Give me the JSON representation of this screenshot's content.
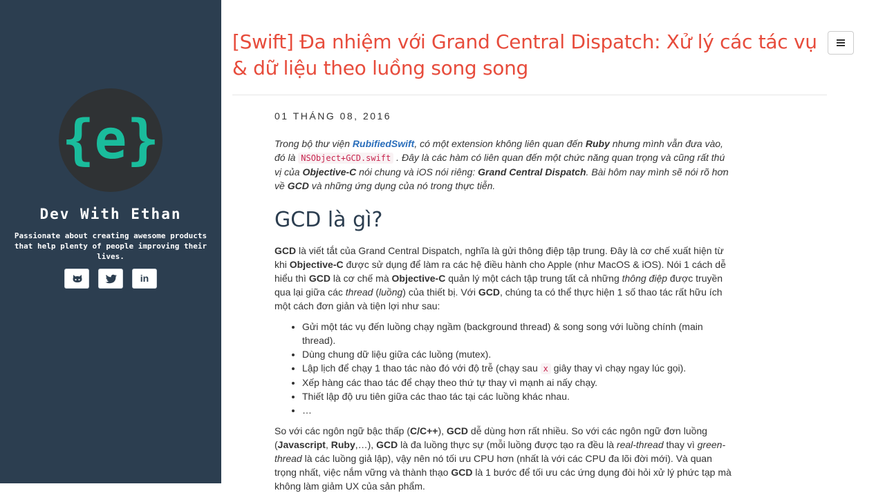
{
  "sidebar": {
    "avatar_glyph": "{e}",
    "site_title": "Dev With Ethan",
    "tagline": "Passionate about creating awesome products that help plenty of people improving their lives.",
    "socials": [
      {
        "icon": "github-icon"
      },
      {
        "icon": "twitter-icon"
      },
      {
        "icon": "linkedin-icon",
        "text": "in"
      }
    ],
    "colors": {
      "background": "#2c3e50",
      "avatar_accent": "#1abc9c"
    }
  },
  "header": {
    "title": "[Swift] Đa nhiệm với Grand Central Dispatch: Xử lý các tác vụ & dữ liệu theo luồng song song",
    "menu_icon": "hamburger-icon",
    "title_color": "#e74c3c"
  },
  "post": {
    "date": "01 tháng 08, 2016",
    "intro": {
      "t1": "Trong bộ thư viện ",
      "link": "RubifiedSwift",
      "t2": ", có một extension không liên quan đến ",
      "b1": "Ruby",
      "t3": " nhưng mình vẫn đưa vào, đó là ",
      "code": "NSObject+GCD.swift",
      "t4": " . Đây là các hàm có liên quan đến một chức năng quan trọng và cũng rất thú vị của ",
      "b2": "Objective-C",
      "t5": " nói chung và iOS nói riêng: ",
      "b3": "Grand Central Dispatch",
      "t6": ". Bài hôm nay mình sẽ nói rõ hơn về ",
      "b4": "GCD",
      "t7": " và những ứng dụng của nó trong thực tiễn."
    },
    "h2": "GCD là gì?",
    "p1": {
      "b1": "GCD",
      "t1": " là viết tắt của Grand Central Dispatch, nghĩa là gửi thông điệp tập trung. Đây là cơ chế xuất hiện từ khi ",
      "b2": "Objective-C",
      "t2": " được sử dụng để làm ra các hệ điều hành cho Apple (như MacOS & iOS). Nói 1 cách dễ hiểu thì ",
      "b3": "GCD",
      "t3": " là cơ chế mà ",
      "b4": "Objective-C",
      "t4": " quản lý một cách tập trung tất cả những ",
      "i1": "thông điệp",
      "t5": " được truyền qua lại giữa các ",
      "i2": "thread",
      "t6": " (",
      "i3": "luồng",
      "t7": ") của thiết bị. Với ",
      "b5": "GCD",
      "t8": ", chúng ta có thể thực hiện 1 số thao tác rất hữu ích một cách đơn giản và tiện lợi như sau:"
    },
    "list": {
      "i1": "Gửi một tác vụ đến luồng chạy ngầm (background thread) & song song với luồng chính (main thread).",
      "i2": "Dùng chung dữ liệu giữa các luồng (mutex).",
      "i3a": "Lập lịch để chạy 1 thao tác nào đó với độ trễ (chạy sau ",
      "i3code": "x",
      "i3b": " giây thay vì chạy ngay lúc gọi).",
      "i4": "Xếp hàng các thao tác để chạy theo thứ tự thay vì mạnh ai nấy chạy.",
      "i5": "Thiết lập độ ưu tiên giữa các thao tác tại các luồng khác nhau.",
      "i6": "…"
    },
    "p2": {
      "t1": "So với các ngôn ngữ bậc thấp (",
      "b1": "C/C++",
      "t2": "), ",
      "b2": "GCD",
      "t3": " dễ dùng hơn rất nhiều. So với các ngôn ngữ đơn luồng (",
      "b3": "Javascript",
      "t4": ", ",
      "b4": "Ruby",
      "t5": ",…), ",
      "b5": "GCD",
      "t6": " là đa luồng thực sự (mỗi luồng được tạo ra đều là ",
      "i1": "real-thread",
      "t7": " thay vì ",
      "i2": "green-thread",
      "t8": " là các luồng giả lập), vậy nên nó tối ưu CPU hơn (nhất là với các CPU đa lõi đời mới). Và quan trọng nhất, việc nắm vững và thành thạo ",
      "b6": "GCD",
      "t9": " là 1 bước để tối ưu các ứng dụng đòi hỏi xử lý phức tạp mà không làm giảm UX của sản phẩm."
    }
  }
}
